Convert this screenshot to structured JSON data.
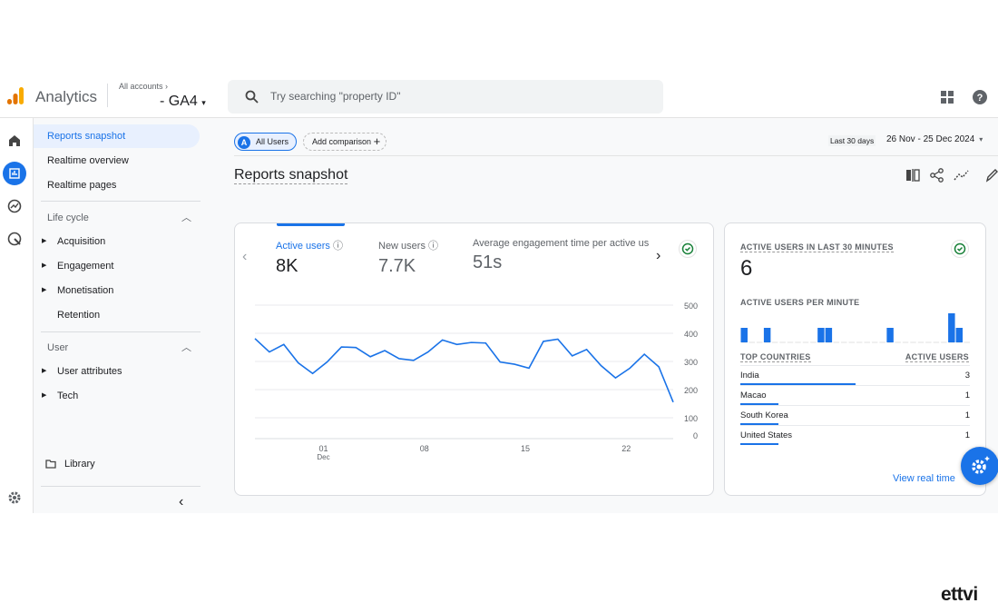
{
  "header": {
    "app_name": "Analytics",
    "breadcrumb": "All accounts",
    "property": "- GA4",
    "search_placeholder": "Try searching \"property ID\""
  },
  "sidebar": {
    "items": [
      {
        "label": "Reports snapshot"
      },
      {
        "label": "Realtime overview"
      },
      {
        "label": "Realtime pages"
      }
    ],
    "lifecycle": {
      "title": "Life cycle",
      "items": [
        {
          "label": "Acquisition"
        },
        {
          "label": "Engagement"
        },
        {
          "label": "Monetisation"
        },
        {
          "label": "Retention"
        }
      ]
    },
    "user": {
      "title": "User",
      "items": [
        {
          "label": "User attributes"
        },
        {
          "label": "Tech"
        }
      ]
    },
    "library": "Library"
  },
  "toolbar": {
    "segment_letter": "A",
    "segment": "All Users",
    "add_comparison": "Add comparison",
    "date_preset": "Last 30 days",
    "date_range": "26 Nov - 25 Dec 2024"
  },
  "page_title": "Reports snapshot",
  "metrics": [
    {
      "label": "Active users",
      "value": "8K"
    },
    {
      "label": "New users",
      "value": "7.7K"
    },
    {
      "label": "Average engagement time per active us",
      "value": "51s"
    }
  ],
  "chart_data": {
    "type": "line",
    "series": [
      {
        "values": [
          380,
          332,
          359,
          293,
          255,
          296,
          350,
          348,
          315,
          337,
          308,
          302,
          332,
          375,
          359,
          366,
          364,
          296,
          288,
          274,
          370,
          378,
          318,
          341,
          283,
          239,
          274,
          324,
          279,
          152
        ]
      }
    ],
    "x": [
      "26 Nov",
      "27 Nov",
      "28 Nov",
      "29 Nov",
      "30 Nov",
      "01 Dec",
      "02 Dec",
      "03 Dec",
      "04 Dec",
      "05 Dec",
      "06 Dec",
      "07 Dec",
      "08 Dec",
      "09 Dec",
      "10 Dec",
      "11 Dec",
      "12 Dec",
      "13 Dec",
      "14 Dec",
      "15 Dec",
      "16 Dec",
      "17 Dec",
      "18 Dec",
      "19 Dec",
      "20 Dec",
      "21 Dec",
      "22 Dec",
      "23 Dec",
      "24 Dec",
      "25 Dec"
    ],
    "x_ticks": [
      {
        "label": "01",
        "sub": "Dec",
        "index": 5
      },
      {
        "label": "08",
        "index": 12
      },
      {
        "label": "15",
        "index": 19
      },
      {
        "label": "22",
        "index": 26
      }
    ],
    "y_ticks": [
      "500",
      "400",
      "300",
      "200",
      "100",
      "0"
    ],
    "ylim": [
      0,
      500
    ],
    "grid": true,
    "color": "#1a73e8"
  },
  "realtime": {
    "title": "ACTIVE USERS IN LAST 30 MINUTES",
    "value": "6",
    "per_minute_title": "ACTIVE USERS PER MINUTE",
    "per_minute": [
      1,
      0,
      0,
      1,
      0,
      0,
      0,
      0,
      0,
      0,
      1,
      1,
      0,
      0,
      0,
      0,
      0,
      0,
      0,
      1,
      0,
      0,
      0,
      0,
      0,
      0,
      0,
      2,
      1,
      0
    ],
    "col_country": "TOP COUNTRIES",
    "col_users": "ACTIVE USERS",
    "countries": [
      {
        "name": "India",
        "users": "3",
        "share": 0.5
      },
      {
        "name": "Macao",
        "users": "1",
        "share": 0.167
      },
      {
        "name": "South Korea",
        "users": "1",
        "share": 0.167
      },
      {
        "name": "United States",
        "users": "1",
        "share": 0.167
      }
    ],
    "view_link": "View real time"
  },
  "brand": "ettvi",
  "colors": {
    "accent": "#1a73e8",
    "success": "#188038",
    "logo_orange": "#f9ab00",
    "logo_dark": "#e37400"
  }
}
